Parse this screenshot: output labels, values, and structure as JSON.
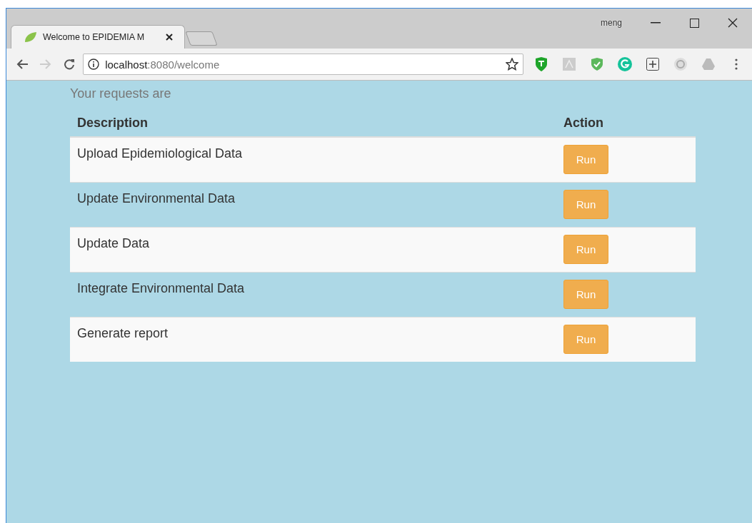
{
  "window": {
    "user": "meng"
  },
  "tabs": [
    {
      "title": "Welcome to EPIDEMIA M",
      "selected": true
    }
  ],
  "address_bar": {
    "host": "localhost",
    "path": ":8080/welcome"
  },
  "page": {
    "intro": "Your requests are",
    "table": {
      "columns": [
        "Description",
        "Action"
      ],
      "rows": [
        {
          "description": "Upload Epidemiological Data",
          "action": "Run"
        },
        {
          "description": "Update Environmental Data",
          "action": "Run"
        },
        {
          "description": "Update Data",
          "action": "Run"
        },
        {
          "description": "Integrate Environmental Data",
          "action": "Run"
        },
        {
          "description": "Generate report",
          "action": "Run"
        }
      ]
    }
  }
}
